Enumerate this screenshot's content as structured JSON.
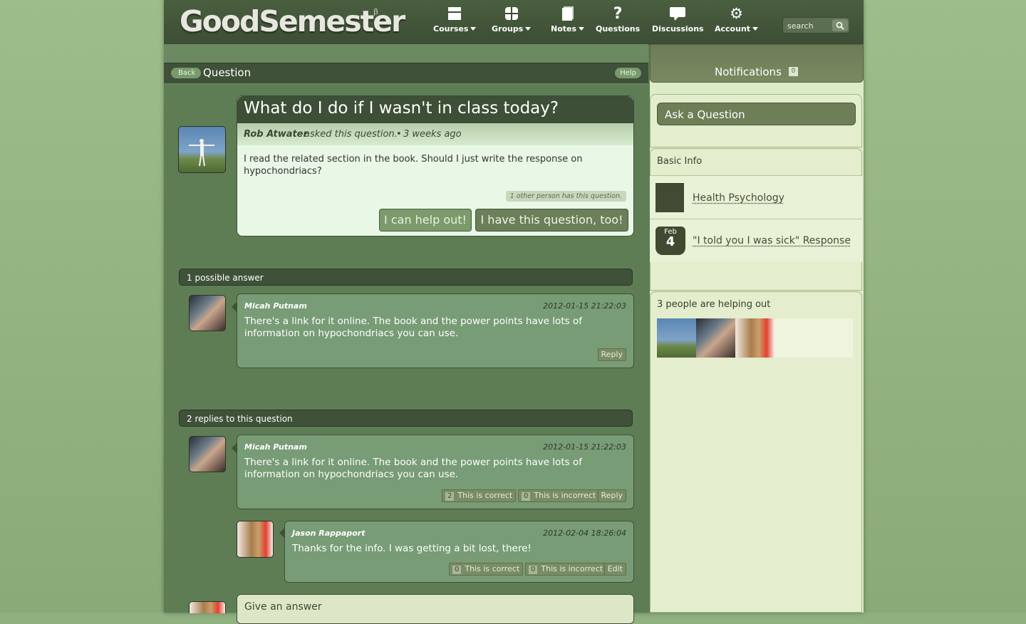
{
  "app": {
    "logo": "GoodSemester",
    "beta": "β"
  },
  "nav": [
    {
      "label": "Courses",
      "icon": "courses-icon",
      "dropdown": true
    },
    {
      "label": "Groups",
      "icon": "groups-icon",
      "dropdown": true
    },
    {
      "label": "Notes",
      "icon": "notes-icon",
      "dropdown": true
    },
    {
      "label": "Questions",
      "icon": "question-mark-icon",
      "dropdown": false
    },
    {
      "label": "Discussions",
      "icon": "discussion-bubble-icon",
      "dropdown": false
    },
    {
      "label": "Account",
      "icon": "gear-icon",
      "dropdown": true
    }
  ],
  "search": {
    "placeholder": "search"
  },
  "header": {
    "back": "Back",
    "title": "Question",
    "help": "Help"
  },
  "question": {
    "title": "What do I do if I wasn't in class today?",
    "author": "Rob Atwater",
    "asked": "asked this question.",
    "bullet": "•",
    "time": "3 weeks ago",
    "body": "I read the related section in the book. Should I just write the response on hypochondriacs?",
    "other_count_text": "1 other person has this question.",
    "help_button": "I can help out!",
    "too_button": "I have this question, too!"
  },
  "answers_section": {
    "title": "1 possible answer"
  },
  "answer1": {
    "name": "Micah Putnam",
    "date": "2012-01-15 21:22:03",
    "text": "There's a link for it online. The book and the power points have lots of information on hypochondriacs you can use.",
    "reply": "Reply"
  },
  "replies_section": {
    "title": "2 replies to this question"
  },
  "reply1": {
    "name": "Micah Putnam",
    "date": "2012-01-15 21:22:03",
    "text": "There's a link for it online. The book and the power points have lots of information on hypochondriacs you can use.",
    "correct_count": "2",
    "correct_label": "This is correct",
    "incorrect_count": "0",
    "incorrect_label": "This is incorrect",
    "reply": "Reply"
  },
  "reply2": {
    "name": "Jason Rappaport",
    "date": "2012-02-04 18:26:04",
    "text": "Thanks for the info. I was getting a bit lost, there!",
    "correct_count": "0",
    "correct_label": "This is correct",
    "incorrect_count": "0",
    "incorrect_label": "This is incorrect",
    "edit": "Edit"
  },
  "give_answer": {
    "title": "Give an answer"
  },
  "sidebar": {
    "notifications": "Notifications",
    "notifications_count": "0",
    "ask": "Ask a Question",
    "basic_info": "Basic Info",
    "course": "Health Psychology",
    "date_month": "Feb",
    "date_day": "4",
    "assignment": "\"I told you I was sick\" Response",
    "helping": "3 people are helping out"
  }
}
